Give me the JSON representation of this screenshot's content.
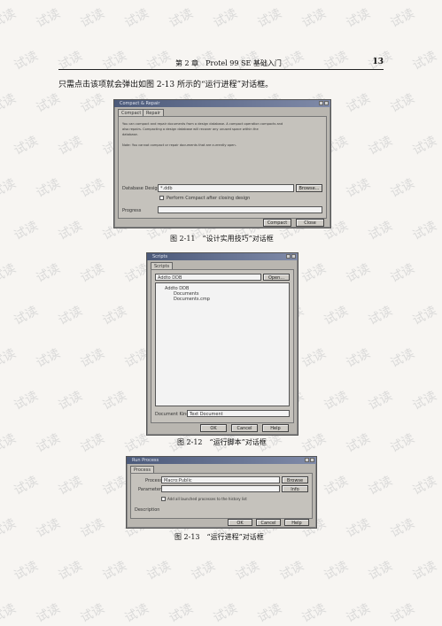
{
  "header": {
    "chapter": "第 2 章　Protel 99 SE 基础入门",
    "page_number": "13"
  },
  "intro_text": "只需点击该项就会弹出如图 2-13 所示的“运行进程”对话框。",
  "watermark_text": "试读",
  "figure1": {
    "title": "Compact & Repair",
    "tabs": [
      "Compact",
      "Repair"
    ],
    "desc_line1": "You can compact and repair documents from a design database. A compact operation compacts and",
    "desc_line2": "also repairs. Compacting a design database will recover any unused space within the",
    "desc_line3": "database.",
    "note": "Note: You cannot compact or repair documents that are currently open.",
    "field_label": "Database Design",
    "field_value": "*.ddb",
    "browse_button": "Browse...",
    "checkbox_label": "Perform Compact after closing design",
    "progress_label": "Progress",
    "ok_button": "Compact",
    "close_button": "Close",
    "caption": "图 2-11　“设计实用技巧”对话框"
  },
  "figure2": {
    "title": "Scripts",
    "tab": "Scripts",
    "combo_value": "Addto DDB",
    "combo_button": "Open...",
    "tree_root": "Addto DDB",
    "tree_items": [
      "Documents",
      "Documents.cmp"
    ],
    "doc_kind_label": "Document Kind",
    "doc_kind_value": "Text Document",
    "ok_button": "OK",
    "cancel_button": "Cancel",
    "help_button": "Help",
    "caption": "图 2-12　“运行脚本”对话框"
  },
  "figure3": {
    "title": "Run Process",
    "tab": "Process",
    "process_label": "Process",
    "process_value": "Macro:Public",
    "browse_button": "Browse",
    "params_label": "Parameters",
    "info_button": "Info",
    "checkbox_label": "Add all launched processes to the history list",
    "description_label": "Description",
    "ok_button": "OK",
    "cancel_button": "Cancel",
    "help_button": "Help",
    "caption": "图 2-13　“运行进程”对话框"
  }
}
